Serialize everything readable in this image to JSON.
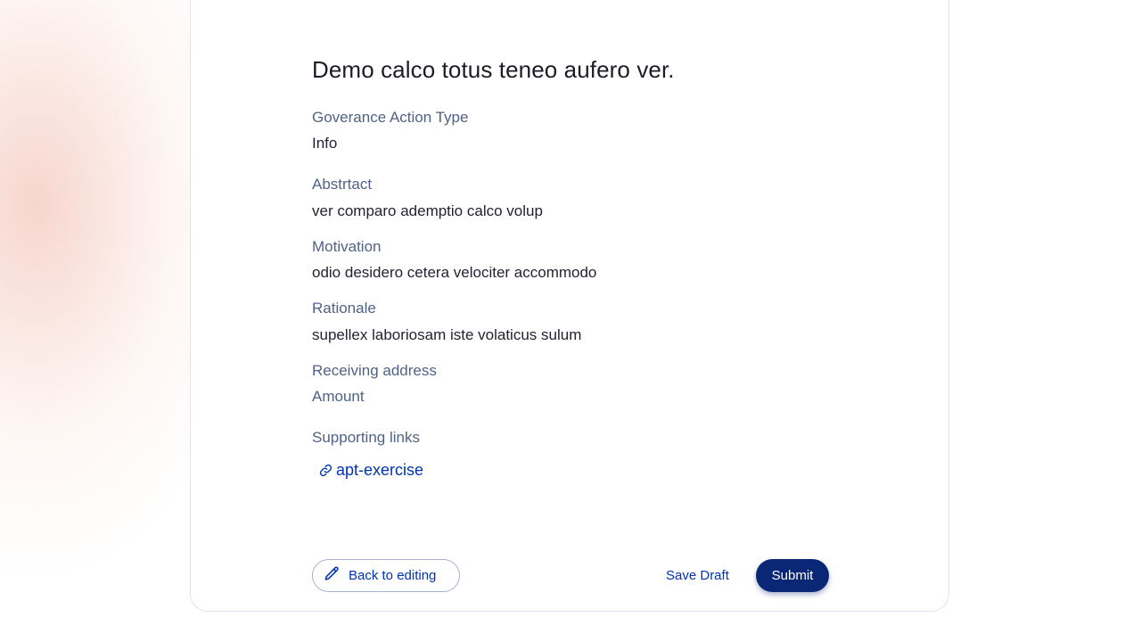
{
  "proposal": {
    "title": "Demo calco totus teneo aufero ver.",
    "fields": [
      {
        "label": "Goverance Action Type",
        "value": "Info"
      },
      {
        "label": "Abstrtact",
        "value": "ver comparo ademptio calco volup"
      },
      {
        "label": "Motivation",
        "value": "odio desidero cetera velociter accommodo"
      },
      {
        "label": "Rationale",
        "value": "supellex laboriosam iste volaticus sulum"
      }
    ],
    "receiving_address_label": "Receiving address",
    "amount_label": "Amount",
    "supporting_links_label": "Supporting links",
    "links": [
      {
        "text": "apt-exercise",
        "icon": "link-icon"
      }
    ]
  },
  "actions": {
    "back_label": "Back to editing",
    "back_icon": "pencil-icon",
    "save_draft_label": "Save Draft",
    "submit_label": "Submit"
  },
  "colors": {
    "primary": "#0033ad",
    "submit_bg": "#0a2775",
    "label": "#506285",
    "text": "#242232"
  }
}
